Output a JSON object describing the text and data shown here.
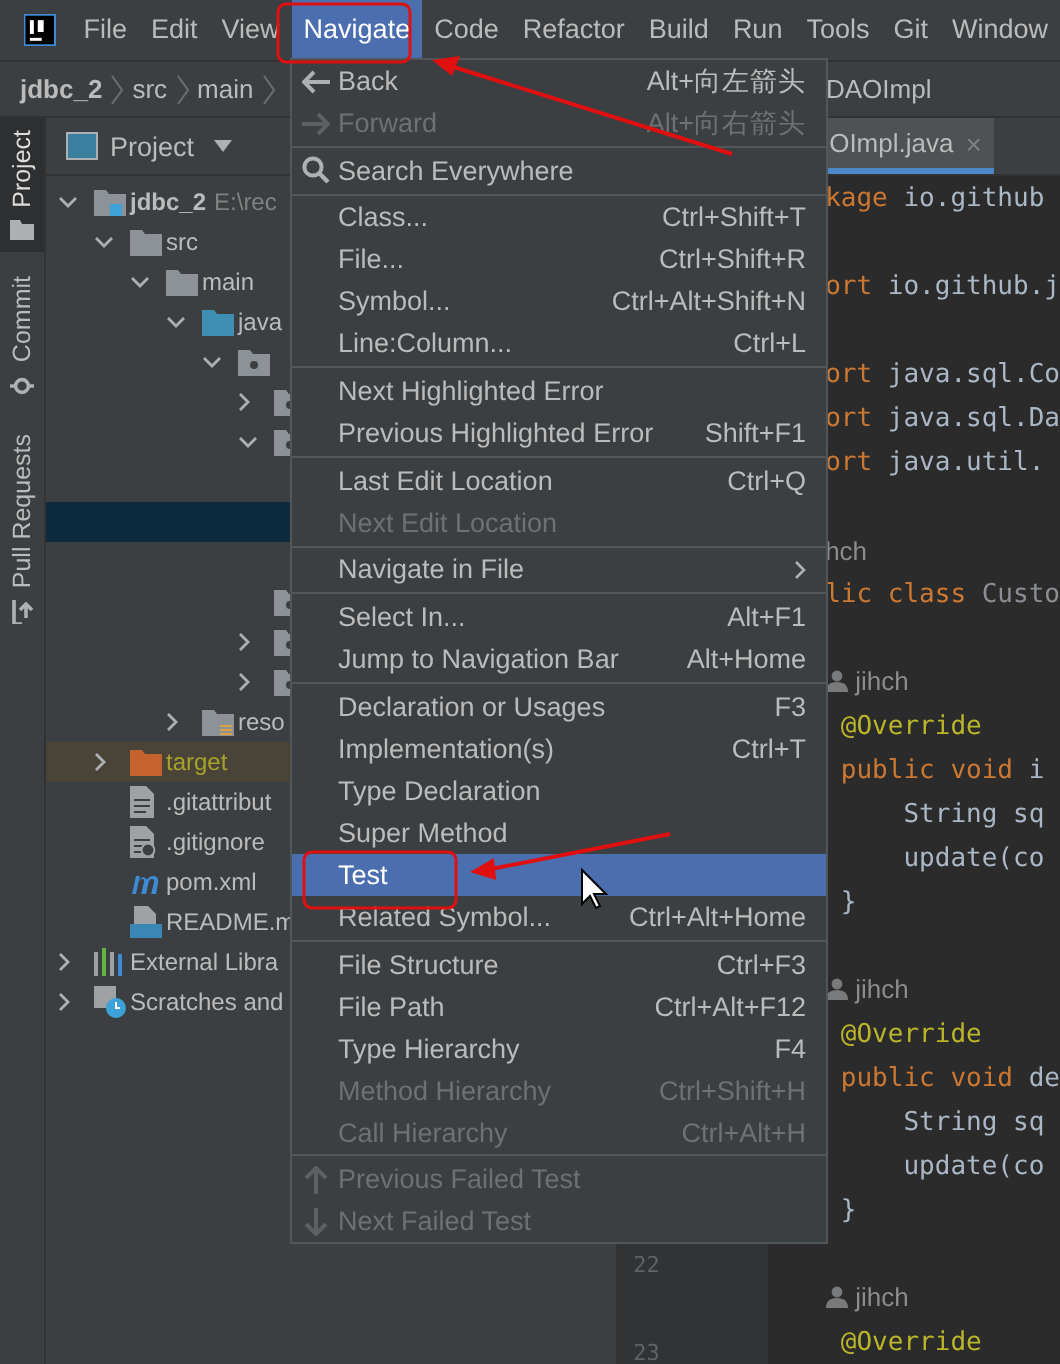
{
  "menu_bar": [
    {
      "label": "File",
      "selected": false
    },
    {
      "label": "Edit",
      "selected": false
    },
    {
      "label": "View",
      "selected": false
    },
    {
      "label": "Navigate",
      "selected": true
    },
    {
      "label": "Code",
      "selected": false
    },
    {
      "label": "Refactor",
      "selected": false
    },
    {
      "label": "Build",
      "selected": false
    },
    {
      "label": "Run",
      "selected": false
    },
    {
      "label": "Tools",
      "selected": false
    },
    {
      "label": "Git",
      "selected": false
    },
    {
      "label": "Window",
      "selected": false
    }
  ],
  "breadcrumbs": {
    "left": [
      "jdbc_2",
      "src",
      "main"
    ],
    "right": [
      "DAOImpl"
    ]
  },
  "tool_windows": [
    {
      "label": "Project",
      "kind": "project",
      "selected": true
    },
    {
      "label": "Commit",
      "kind": "commit",
      "selected": false
    },
    {
      "label": "Pull Requests",
      "kind": "pull",
      "selected": false
    }
  ],
  "project_panel": {
    "title": "Project",
    "tree": [
      {
        "label": "jdbc_2",
        "path": "E:\\rec",
        "kind": "module",
        "expanded": true,
        "selected": false,
        "children": [
          {
            "label": "src",
            "kind": "folder",
            "expanded": true,
            "selected": false,
            "children": [
              {
                "label": "main",
                "kind": "folder",
                "expanded": true,
                "selected": false,
                "children": [
                  {
                    "label": "java",
                    "kind": "source",
                    "expanded": true,
                    "selected": false,
                    "children": [
                      {
                        "kind": "package",
                        "expanded": true,
                        "selected": false,
                        "children": [
                          {
                            "kind": "package",
                            "expanded": false,
                            "selected": false
                          },
                          {
                            "kind": "package",
                            "expanded": true,
                            "selected": false,
                            "children": [
                              {
                                "selected": false
                              },
                              {
                                "selected": true
                              },
                              {
                                "selected": false
                              }
                            ]
                          },
                          {
                            "kind": "package",
                            "selected": false
                          },
                          {
                            "kind": "package",
                            "expanded": false,
                            "selected": false
                          },
                          {
                            "kind": "package",
                            "expanded": false,
                            "selected": false
                          }
                        ]
                      }
                    ]
                  },
                  {
                    "label": "reso",
                    "kind": "resources",
                    "expanded": false,
                    "selected": false
                  }
                ]
              }
            ]
          },
          {
            "label": "target",
            "kind": "excluded",
            "expanded": false,
            "selected": false
          },
          {
            "label": ".gitattribut",
            "kind": "file",
            "selected": false
          },
          {
            "label": ".gitignore",
            "kind": "ignore",
            "selected": false
          },
          {
            "label": "pom.xml",
            "kind": "maven",
            "selected": false
          },
          {
            "label": "README.m",
            "kind": "markdown",
            "selected": false
          }
        ]
      },
      {
        "label": "External Libra",
        "kind": "libraries",
        "expanded": false,
        "selected": false
      },
      {
        "label": "Scratches and",
        "kind": "scratches",
        "expanded": false,
        "selected": false
      }
    ]
  },
  "editor": {
    "tab": {
      "label": "OImpl.java",
      "close": "×"
    },
    "lines": [
      {
        "kind": "code",
        "tokens": [
          {
            "t": "kage",
            "kind": "keyword"
          },
          {
            "t": " io.github",
            "kind": "plain"
          }
        ]
      },
      {
        "kind": "blank"
      },
      {
        "kind": "code",
        "tokens": [
          {
            "t": "ort",
            "kind": "keyword"
          },
          {
            "t": " io.github.j",
            "kind": "plain"
          }
        ]
      },
      {
        "kind": "blank"
      },
      {
        "kind": "code",
        "tokens": [
          {
            "t": "ort",
            "kind": "keyword"
          },
          {
            "t": " java.sql.Co",
            "kind": "plain"
          }
        ]
      },
      {
        "kind": "code",
        "tokens": [
          {
            "t": "ort",
            "kind": "keyword"
          },
          {
            "t": " java.sql.Da",
            "kind": "plain"
          }
        ]
      },
      {
        "kind": "code",
        "tokens": [
          {
            "t": "ort",
            "kind": "keyword"
          },
          {
            "t": " java.util.",
            "kind": "plain"
          }
        ]
      },
      {
        "kind": "blank"
      },
      {
        "kind": "inlay",
        "text": "hch",
        "icon": false
      },
      {
        "kind": "code",
        "tokens": [
          {
            "t": "lic class",
            "kind": "keyword"
          },
          {
            "t": " Custo",
            "kind": "unused"
          }
        ]
      },
      {
        "kind": "blank"
      },
      {
        "kind": "inlay",
        "text": "jihch",
        "icon": true
      },
      {
        "kind": "code",
        "tokens": [
          {
            "t": " @Override",
            "kind": "annotation"
          }
        ]
      },
      {
        "kind": "code",
        "tokens": [
          {
            "t": " public void",
            "kind": "keyword"
          },
          {
            "t": " i",
            "kind": "plain"
          }
        ]
      },
      {
        "kind": "code",
        "tokens": [
          {
            "t": "     String sq",
            "kind": "plain"
          }
        ]
      },
      {
        "kind": "code",
        "tokens": [
          {
            "t": "     update(co",
            "kind": "plain"
          }
        ]
      },
      {
        "kind": "code",
        "tokens": [
          {
            "t": " }",
            "kind": "plain"
          }
        ]
      },
      {
        "kind": "blank"
      },
      {
        "kind": "inlay",
        "text": "jihch",
        "icon": true
      },
      {
        "kind": "code",
        "tokens": [
          {
            "t": " @Override",
            "kind": "annotation"
          }
        ]
      },
      {
        "kind": "code",
        "tokens": [
          {
            "t": " public void",
            "kind": "keyword"
          },
          {
            "t": " de",
            "kind": "plain"
          }
        ]
      },
      {
        "kind": "code",
        "tokens": [
          {
            "t": "     String sq",
            "kind": "plain"
          }
        ]
      },
      {
        "kind": "code",
        "tokens": [
          {
            "t": "     update(co",
            "kind": "plain"
          }
        ]
      },
      {
        "kind": "code",
        "tokens": [
          {
            "t": " }",
            "kind": "plain"
          }
        ]
      },
      {
        "kind": "blank",
        "number": "22"
      },
      {
        "kind": "inlay",
        "text": "jihch",
        "icon": true
      },
      {
        "kind": "code",
        "number": "23",
        "tokens": [
          {
            "t": " @Override",
            "kind": "annotation"
          }
        ]
      }
    ]
  },
  "navigate_menu": [
    {
      "kind": "back",
      "label": "Back",
      "shortcut": "Alt+向左箭头",
      "disabled": false,
      "selected": false
    },
    {
      "kind": "forward",
      "label": "Forward",
      "shortcut": "Alt+向右箭头",
      "disabled": true,
      "selected": false
    },
    {
      "kind": "separator"
    },
    {
      "kind": "search",
      "label": "Search Everywhere",
      "disabled": false,
      "selected": false
    },
    {
      "kind": "separator"
    },
    {
      "kind": "item",
      "label": "Class...",
      "shortcut": "Ctrl+Shift+T",
      "disabled": false,
      "selected": false
    },
    {
      "kind": "item",
      "label": "File...",
      "shortcut": "Ctrl+Shift+R",
      "disabled": false,
      "selected": false
    },
    {
      "kind": "item",
      "label": "Symbol...",
      "shortcut": "Ctrl+Alt+Shift+N",
      "disabled": false,
      "selected": false
    },
    {
      "kind": "item",
      "label": "Line:Column...",
      "shortcut": "Ctrl+L",
      "disabled": false,
      "selected": false
    },
    {
      "kind": "separator"
    },
    {
      "kind": "item",
      "label": "Next Highlighted Error",
      "disabled": false,
      "selected": false
    },
    {
      "kind": "item",
      "label": "Previous Highlighted Error",
      "shortcut": "Shift+F1",
      "disabled": false,
      "selected": false
    },
    {
      "kind": "separator"
    },
    {
      "kind": "item",
      "label": "Last Edit Location",
      "shortcut": "Ctrl+Q",
      "disabled": false,
      "selected": false
    },
    {
      "kind": "item",
      "label": "Next Edit Location",
      "disabled": true,
      "selected": false
    },
    {
      "kind": "separator"
    },
    {
      "kind": "submenu",
      "label": "Navigate in File",
      "disabled": false,
      "selected": false
    },
    {
      "kind": "separator"
    },
    {
      "kind": "item",
      "label": "Select In...",
      "shortcut": "Alt+F1",
      "disabled": false,
      "selected": false
    },
    {
      "kind": "item",
      "label": "Jump to Navigation Bar",
      "shortcut": "Alt+Home",
      "disabled": false,
      "selected": false
    },
    {
      "kind": "separator"
    },
    {
      "kind": "item",
      "label": "Declaration or Usages",
      "shortcut": "F3",
      "disabled": false,
      "selected": false
    },
    {
      "kind": "item",
      "label": "Implementation(s)",
      "shortcut": "Ctrl+T",
      "disabled": false,
      "selected": false
    },
    {
      "kind": "item",
      "label": "Type Declaration",
      "disabled": false,
      "selected": false
    },
    {
      "kind": "item",
      "label": "Super Method",
      "disabled": false,
      "selected": false
    },
    {
      "kind": "item",
      "label": "Test",
      "disabled": false,
      "selected": true
    },
    {
      "kind": "item",
      "label": "Related Symbol...",
      "shortcut": "Ctrl+Alt+Home",
      "disabled": false,
      "selected": false
    },
    {
      "kind": "separator"
    },
    {
      "kind": "item",
      "label": "File Structure",
      "shortcut": "Ctrl+F3",
      "disabled": false,
      "selected": false
    },
    {
      "kind": "item",
      "label": "File Path",
      "shortcut": "Ctrl+Alt+F12",
      "disabled": false,
      "selected": false
    },
    {
      "kind": "item",
      "label": "Type Hierarchy",
      "shortcut": "F4",
      "disabled": false,
      "selected": false
    },
    {
      "kind": "item",
      "label": "Method Hierarchy",
      "shortcut": "Ctrl+Shift+H",
      "disabled": true,
      "selected": false
    },
    {
      "kind": "item",
      "label": "Call Hierarchy",
      "shortcut": "Ctrl+Alt+H",
      "disabled": true,
      "selected": false
    },
    {
      "kind": "separator"
    },
    {
      "kind": "up",
      "label": "Previous Failed Test",
      "disabled": true,
      "selected": false
    },
    {
      "kind": "down",
      "label": "Next Failed Test",
      "disabled": true,
      "selected": false
    }
  ]
}
